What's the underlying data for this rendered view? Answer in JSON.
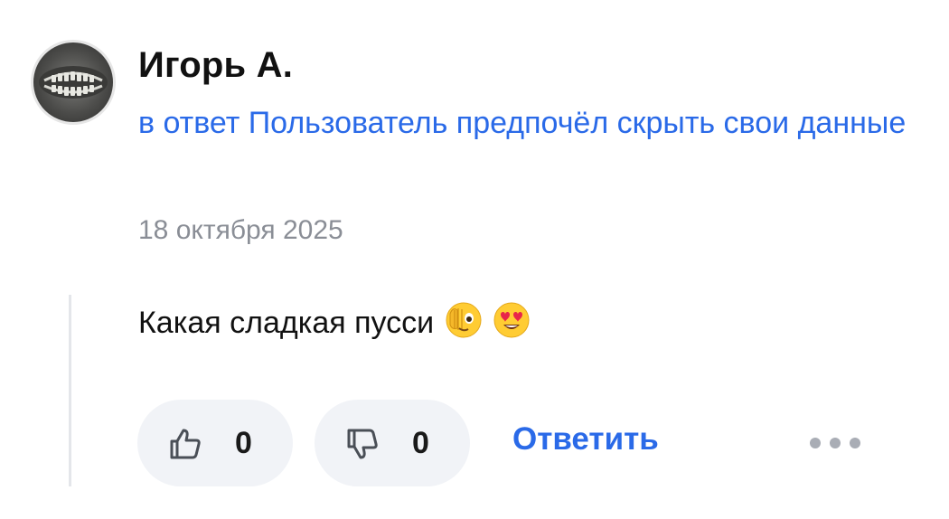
{
  "comment": {
    "author": "Игорь А.",
    "reply_to": "в ответ Пользователь предпочёл скрыть свои данные",
    "date": "18 октября 2025",
    "text": "Какая сладкая пусси",
    "emojis": [
      "face-with-hand-over-eye",
      "heart-eyes"
    ]
  },
  "actions": {
    "like_count": "0",
    "dislike_count": "0",
    "reply_label": "Ответить",
    "more_icon": "ellipsis-icon"
  },
  "colors": {
    "link": "#2a6ae8",
    "date": "#8a8e96",
    "pill_bg": "#f1f3f7"
  }
}
